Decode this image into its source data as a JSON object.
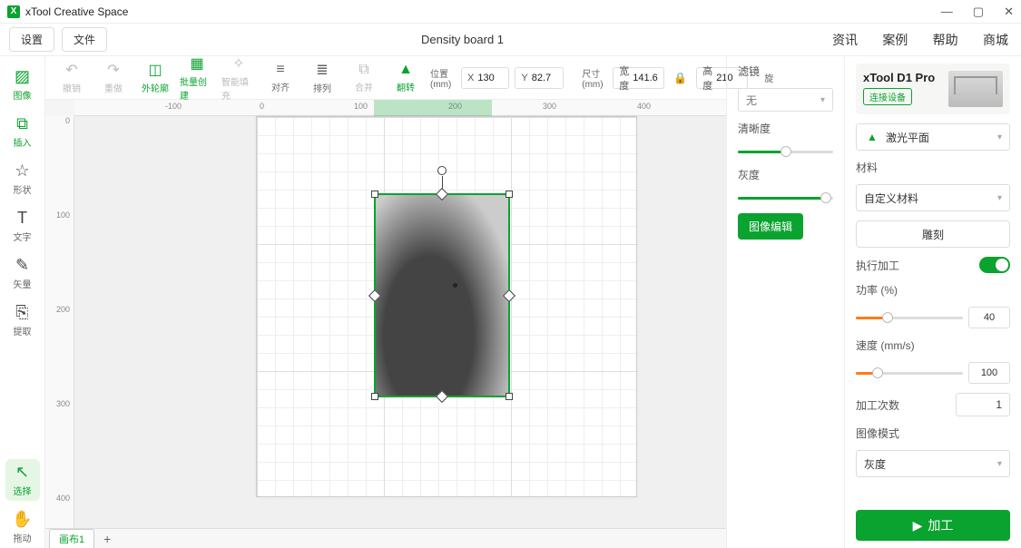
{
  "app": {
    "title": "xTool Creative Space"
  },
  "menubar": {
    "settings": "设置",
    "file": "文件",
    "document_name": "Density board 1",
    "right": {
      "zixun": "资讯",
      "anli": "案例",
      "bangzhu": "帮助",
      "shangcheng": "商城"
    }
  },
  "left_tools": {
    "image": "图像",
    "insert": "插入",
    "shape": "形状",
    "text": "文字",
    "vector": "矢量",
    "extract": "提取",
    "select": "选择",
    "pan": "拖动"
  },
  "toolbar": {
    "undo": "撤销",
    "redo": "重做",
    "outline": "外轮廓",
    "batch_create": "批量创建",
    "smart_fill": "智能填充",
    "align": "对齐",
    "arrange": "排列",
    "combine": "合并",
    "flip": "翻转",
    "position": {
      "label": "位置 (mm)",
      "x_key": "X",
      "x": "130",
      "y_key": "Y",
      "y": "82.7"
    },
    "size": {
      "label": "尺寸 (mm)",
      "w_key": "宽度",
      "w": "141.6",
      "h_key": "高度",
      "h": "210"
    },
    "rotate_label": "旋"
  },
  "ruler": {
    "h": [
      "-100",
      "0",
      "100",
      "200",
      "300",
      "400"
    ],
    "v": [
      "0",
      "100",
      "200",
      "300",
      "400"
    ]
  },
  "bottom_tabs": {
    "tab1": "画布1"
  },
  "mid_panel": {
    "filter_label": "滤镜",
    "filter_value": "无",
    "sharpness_label": "清晰度",
    "sharpness_pct": 50,
    "gray_label": "灰度",
    "gray_pct": 92,
    "edit_image": "图像编辑"
  },
  "right_panel": {
    "device_name": "xTool D1 Pro",
    "connect_label": "连接设备",
    "laser_plane": "激光平面",
    "material_label": "材料",
    "material_value": "自定义材料",
    "engrave": "雕刻",
    "exec_label": "执行加工",
    "exec_on": true,
    "power_label": "功率 (%)",
    "power_value": "40",
    "power_pct": 40,
    "speed_label": "速度 (mm/s)",
    "speed_value": "100",
    "speed_pct": 25,
    "pass_label": "加工次数",
    "pass_value": "1",
    "image_mode_label": "图像模式",
    "image_mode_value": "灰度",
    "process": "加工"
  }
}
